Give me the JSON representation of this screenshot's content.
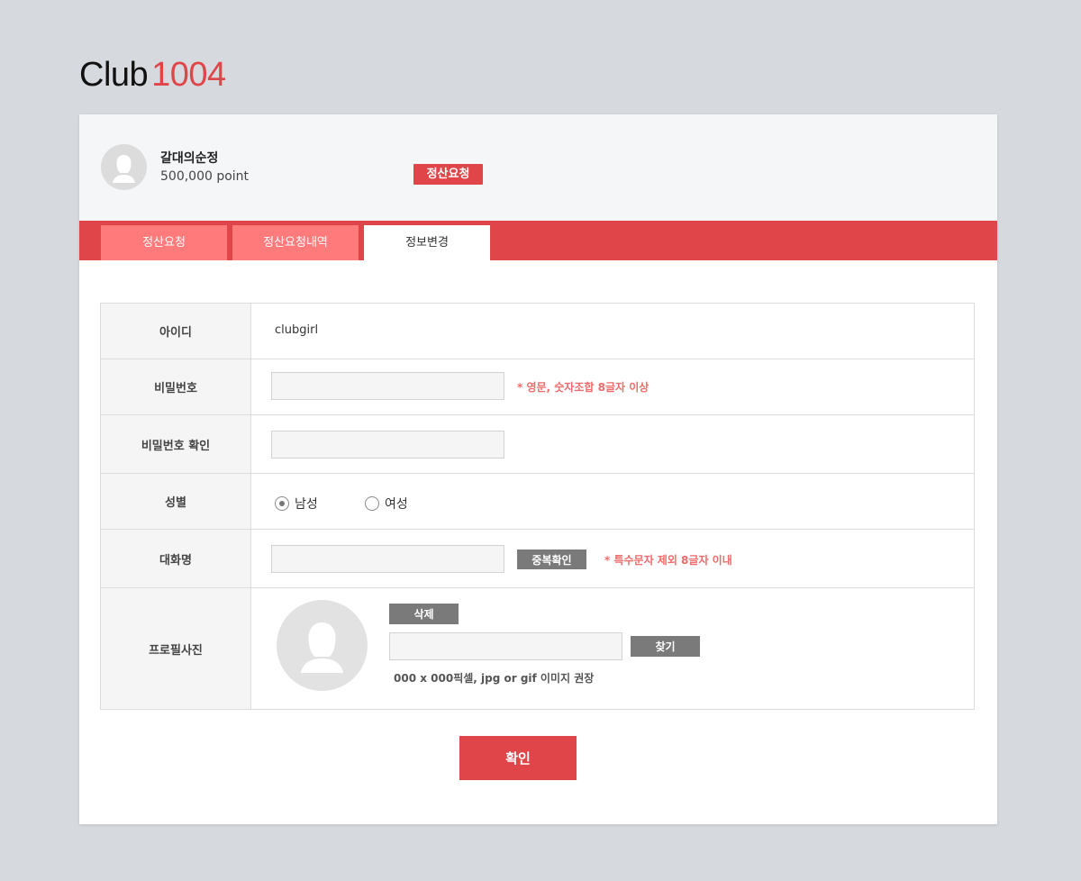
{
  "logo": {
    "club": "Club",
    "number": "1004"
  },
  "profile": {
    "name": "갈대의순정",
    "point": "500,000 point",
    "request_badge": "정산요청"
  },
  "tabs": [
    {
      "label": "정산요청"
    },
    {
      "label": "정산요청내역"
    },
    {
      "label": "정보변경",
      "active": true
    }
  ],
  "form": {
    "id": {
      "label": "아이디",
      "value": "clubgirl"
    },
    "password": {
      "label": "비밀번호",
      "value": "",
      "hint": "* 영문, 숫자조합 8글자 이상"
    },
    "password_confirm": {
      "label": "비밀번호 확인",
      "value": ""
    },
    "gender": {
      "label": "성별",
      "options": [
        "남성",
        "여성"
      ],
      "selected": "남성"
    },
    "nickname": {
      "label": "대화명",
      "value": "",
      "check_button": "중복확인",
      "hint": "* 특수문자 제외 8글자 이내"
    },
    "photo": {
      "label": "프로필사진",
      "delete_button": "삭제",
      "file_value": "",
      "browse_button": "찾기",
      "note": "000 x 000픽셀, jpg or gif 이미지 권장"
    }
  },
  "confirm_button": "확인",
  "colors": {
    "accent": "#e0454a",
    "tab_inactive": "#ff7b7b",
    "hint": "#f06b6b",
    "background": "#d6dadf"
  }
}
